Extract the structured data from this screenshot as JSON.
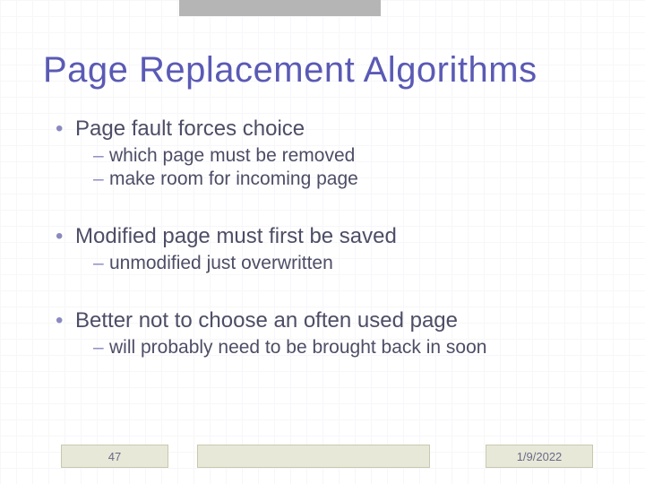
{
  "title": "Page Replacement Algorithms",
  "bullets": [
    {
      "text": "Page fault forces choice",
      "subs": [
        "which page must be removed",
        "make room for incoming page"
      ]
    },
    {
      "text": "Modified page must first be saved",
      "subs": [
        "unmodified just overwritten"
      ]
    },
    {
      "text": "Better not to choose an often used page",
      "subs": [
        "will probably need to be brought back in soon"
      ]
    }
  ],
  "footer": {
    "page_number": "47",
    "date": "1/9/2022"
  }
}
